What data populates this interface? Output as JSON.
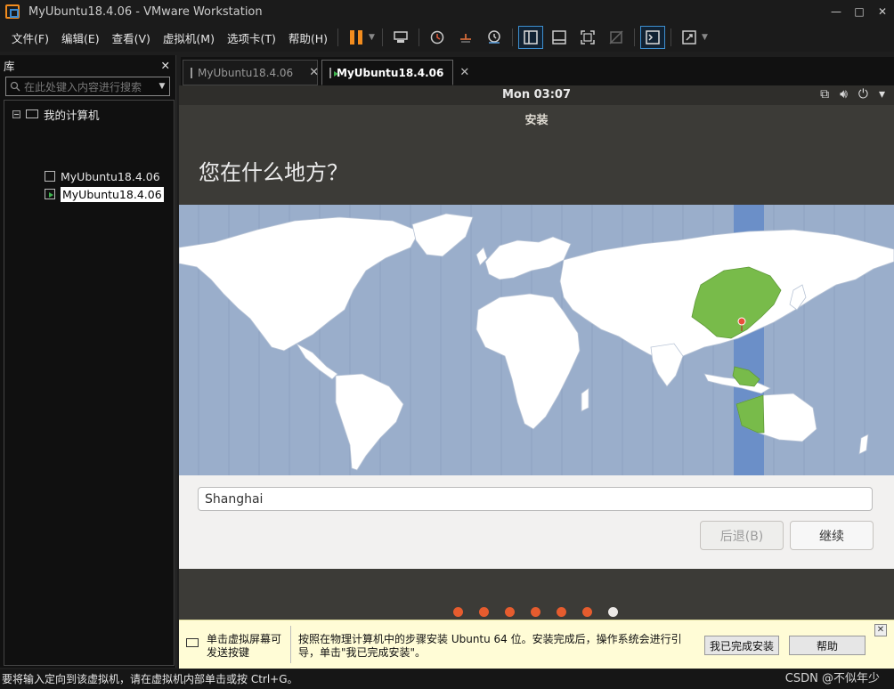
{
  "window": {
    "title": "MyUbuntu18.4.06 - VMware Workstation",
    "minimize": "—",
    "maximize": "□",
    "close": "✕"
  },
  "menu": [
    "文件(F)",
    "编辑(E)",
    "查看(V)",
    "虚拟机(M)",
    "选项卡(T)",
    "帮助(H)"
  ],
  "library": {
    "title": "库",
    "close": "✕",
    "search_placeholder": "在此处键入内容进行搜索",
    "root_label": "我的计算机",
    "items": [
      "MyUbuntu18.4.06",
      "MyUbuntu18.4.06"
    ]
  },
  "tabs": [
    {
      "label": "MyUbuntu18.4.06",
      "active": false
    },
    {
      "label": "MyUbuntu18.4.06",
      "active": true
    }
  ],
  "tab_close": "✕",
  "guest": {
    "clock": "Mon 03:07",
    "installer_title": "安装",
    "question": "您在什么地方？",
    "city_value": "Shanghai",
    "back_button": "后退(B)",
    "continue_button": "继续",
    "progress": {
      "total_steps": 7,
      "current_step": 7
    },
    "colors": {
      "map_bg": "#9aaecb",
      "land": "#ffffff",
      "selected_zone": "#78bb4a",
      "zone_strip": "#6b8fc8",
      "dot": "#e65c2e"
    }
  },
  "infobar": {
    "left_text": "单击虚拟屏幕可发送按键",
    "main_text": "按照在物理计算机中的步骤安装 Ubuntu 64 位。安装完成后，操作系统会进行引导，单击\"我已完成安装\"。",
    "done_button": "我已完成安装",
    "help_button": "帮助",
    "close": "✕"
  },
  "status": {
    "text": "要将输入定向到该虚拟机，请在虚拟机内部单击或按 Ctrl+G。",
    "watermark": "CSDN @不似年少"
  }
}
